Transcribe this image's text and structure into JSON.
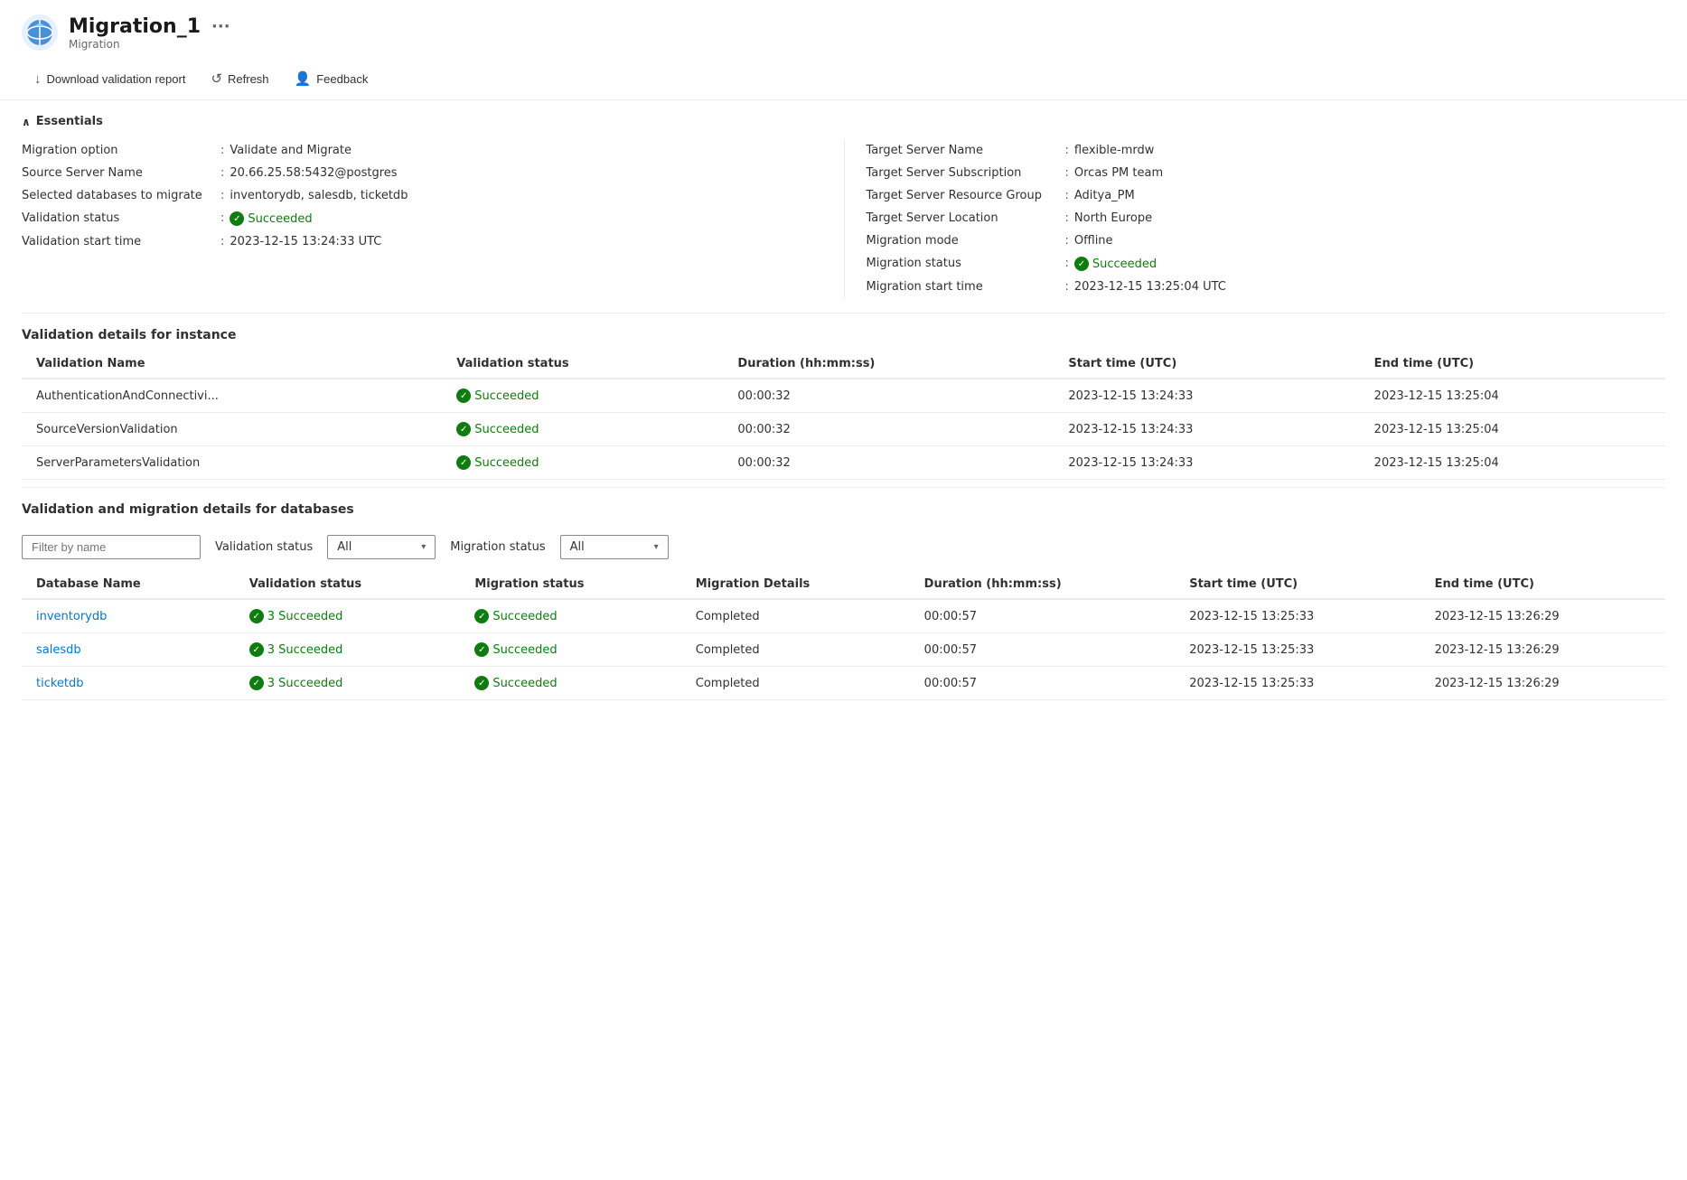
{
  "header": {
    "title": "Migration_1",
    "subtitle": "Migration",
    "ellipsis": "···"
  },
  "toolbar": {
    "download_label": "Download validation report",
    "refresh_label": "Refresh",
    "feedback_label": "Feedback"
  },
  "essentials": {
    "section_title": "Essentials",
    "left": [
      {
        "label": "Migration option",
        "value": "Validate and Migrate"
      },
      {
        "label": "Source Server Name",
        "value": "20.66.25.58:5432@postgres"
      },
      {
        "label": "Selected databases to migrate",
        "value": "inventorydb, salesdb, ticketdb"
      },
      {
        "label": "Validation status",
        "value": "Succeeded",
        "status": true
      },
      {
        "label": "Validation start time",
        "value": "2023-12-15 13:24:33 UTC"
      }
    ],
    "right": [
      {
        "label": "Target Server Name",
        "value": "flexible-mrdw"
      },
      {
        "label": "Target Server Subscription",
        "value": "Orcas PM team"
      },
      {
        "label": "Target Server Resource Group",
        "value": "Aditya_PM"
      },
      {
        "label": "Target Server Location",
        "value": "North Europe"
      },
      {
        "label": "Migration mode",
        "value": "Offline"
      },
      {
        "label": "Migration status",
        "value": "Succeeded",
        "status": true
      },
      {
        "label": "Migration start time",
        "value": "2023-12-15 13:25:04 UTC"
      }
    ]
  },
  "validation_details": {
    "section_title": "Validation details for instance",
    "columns": [
      "Validation Name",
      "Validation status",
      "Duration (hh:mm:ss)",
      "Start time (UTC)",
      "End time (UTC)"
    ],
    "rows": [
      {
        "name": "AuthenticationAndConnectivi...",
        "status": "Succeeded",
        "duration": "00:00:32",
        "start": "2023-12-15 13:24:33",
        "end": "2023-12-15 13:25:04"
      },
      {
        "name": "SourceVersionValidation",
        "status": "Succeeded",
        "duration": "00:00:32",
        "start": "2023-12-15 13:24:33",
        "end": "2023-12-15 13:25:04"
      },
      {
        "name": "ServerParametersValidation",
        "status": "Succeeded",
        "duration": "00:00:32",
        "start": "2023-12-15 13:24:33",
        "end": "2023-12-15 13:25:04"
      }
    ]
  },
  "migration_details": {
    "section_title": "Validation and migration details for databases",
    "filter": {
      "placeholder": "Filter by name",
      "validation_label": "Validation status",
      "validation_value": "All",
      "migration_label": "Migration status",
      "migration_value": "All"
    },
    "columns": [
      "Database Name",
      "Validation status",
      "Migration status",
      "Migration Details",
      "Duration (hh:mm:ss)",
      "Start time (UTC)",
      "End time (UTC)"
    ],
    "rows": [
      {
        "name": "inventorydb",
        "validation": "3 Succeeded",
        "migration": "Succeeded",
        "details": "Completed",
        "duration": "00:00:57",
        "start": "2023-12-15 13:25:33",
        "end": "2023-12-15 13:26:29"
      },
      {
        "name": "salesdb",
        "validation": "3 Succeeded",
        "migration": "Succeeded",
        "details": "Completed",
        "duration": "00:00:57",
        "start": "2023-12-15 13:25:33",
        "end": "2023-12-15 13:26:29"
      },
      {
        "name": "ticketdb",
        "validation": "3 Succeeded",
        "migration": "Succeeded",
        "details": "Completed",
        "duration": "00:00:57",
        "start": "2023-12-15 13:25:33",
        "end": "2023-12-15 13:26:29"
      }
    ]
  }
}
